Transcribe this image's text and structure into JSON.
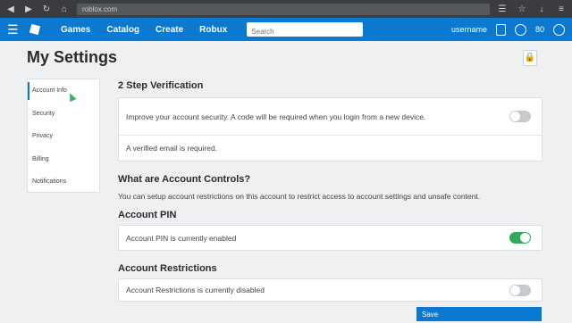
{
  "browser": {
    "url": "roblox.com"
  },
  "nav": {
    "links": [
      "Games",
      "Catalog",
      "Create",
      "Robux"
    ],
    "search_placeholder": "Search",
    "username": "username",
    "robux": "80"
  },
  "page": {
    "title": "My Settings"
  },
  "sidebar": {
    "items": [
      {
        "label": "Account Info"
      },
      {
        "label": "Security"
      },
      {
        "label": "Privacy"
      },
      {
        "label": "Billing"
      },
      {
        "label": "Notifications"
      }
    ]
  },
  "two_step": {
    "title": "2 Step Verification",
    "description": "Improve your account security. A code will be required when you login from a new device.",
    "enabled": false,
    "note": "A verified email is required."
  },
  "controls": {
    "title": "What are Account Controls?",
    "description": "You can setup account restrictions on this account to restrict access to account settings and unsafe content."
  },
  "pin": {
    "title": "Account PIN",
    "status": "Account PIN is currently enabled",
    "enabled": true
  },
  "restrictions": {
    "title": "Account Restrictions",
    "status": "Account Restrictions is currently disabled",
    "enabled": false
  },
  "save_label": "Save",
  "colors": {
    "brand": "#0b79d0",
    "toggle_on": "#2fa95a",
    "toggle_off": "#c7cacd"
  }
}
